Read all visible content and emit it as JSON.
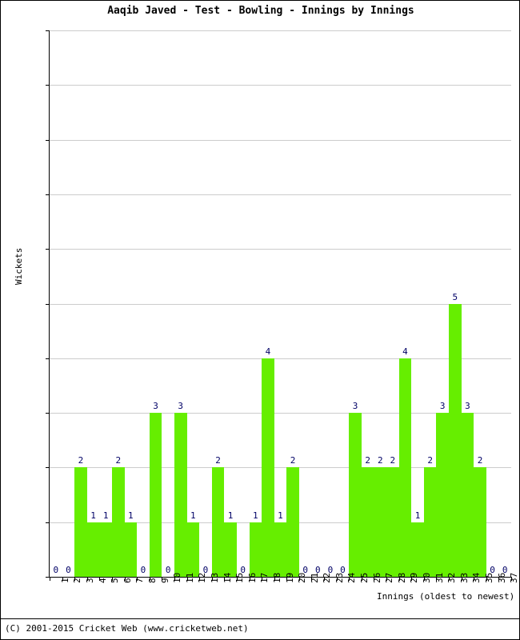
{
  "chart_data": {
    "type": "bar",
    "title": "Aaqib Javed - Test - Bowling - Innings by Innings",
    "xlabel": "Innings (oldest to newest)",
    "ylabel": "Wickets",
    "ylim": [
      0,
      10
    ],
    "ytick_step": 1,
    "grid": true,
    "legend": "none",
    "bar_color": "#66EE00",
    "value_label_color": "#000066",
    "gridline_color": "#CCCCCC",
    "axis_color": "#000000",
    "categories": [
      "1",
      "2",
      "3",
      "4",
      "5",
      "6",
      "7",
      "8",
      "9",
      "10",
      "11",
      "12",
      "13",
      "14",
      "15",
      "16",
      "17",
      "18",
      "19",
      "20",
      "21",
      "22",
      "23",
      "24",
      "25",
      "26",
      "27",
      "28",
      "29",
      "30",
      "31",
      "32",
      "33",
      "34",
      "35",
      "36",
      "37"
    ],
    "values": [
      0,
      0,
      2,
      1,
      1,
      2,
      1,
      0,
      3,
      0,
      3,
      1,
      0,
      2,
      1,
      0,
      1,
      4,
      1,
      2,
      0,
      0,
      0,
      0,
      3,
      2,
      2,
      2,
      4,
      1,
      2,
      3,
      5,
      3,
      2,
      0,
      0
    ],
    "yticks": [
      "0",
      "1",
      "2",
      "3",
      "4",
      "5",
      "6",
      "7",
      "8",
      "9",
      "10"
    ]
  },
  "footer": {
    "copyright": "(C) 2001-2015 Cricket Web (www.cricketweb.net)"
  }
}
